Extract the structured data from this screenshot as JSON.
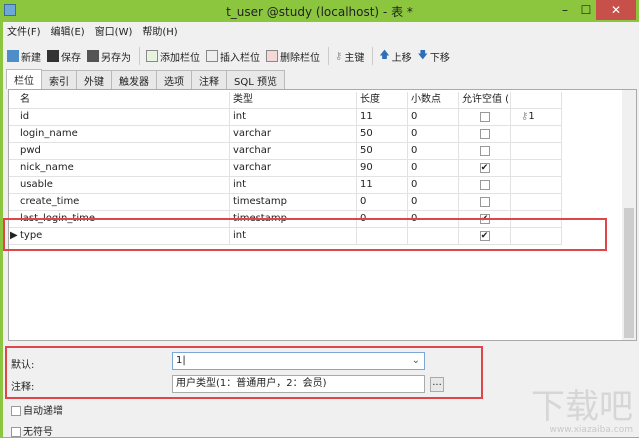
{
  "window": {
    "title": "t_user @study (localhost) - 表 *",
    "minimize": "–",
    "maximize": "☐",
    "close": "✕"
  },
  "menu": [
    "文件(F)",
    "编辑(E)",
    "窗口(W)",
    "帮助(H)"
  ],
  "toolbar": {
    "new": "新建",
    "save": "保存",
    "save_as": "另存为",
    "add_field": "添加栏位",
    "insert_field": "插入栏位",
    "delete_field": "删除栏位",
    "primary_key": "主键",
    "move_up": "上移",
    "move_down": "下移"
  },
  "tabs": [
    "栏位",
    "索引",
    "外键",
    "触发器",
    "选项",
    "注释",
    "SQL 预览"
  ],
  "grid": {
    "headers": [
      "名",
      "类型",
      "长度",
      "小数点",
      "允许空值 ("
    ],
    "rows": [
      {
        "name": "id",
        "type": "int",
        "length": "11",
        "decimal": "0",
        "nullable": false,
        "key": "1"
      },
      {
        "name": "login_name",
        "type": "varchar",
        "length": "50",
        "decimal": "0",
        "nullable": false,
        "key": ""
      },
      {
        "name": "pwd",
        "type": "varchar",
        "length": "50",
        "decimal": "0",
        "nullable": false,
        "key": ""
      },
      {
        "name": "nick_name",
        "type": "varchar",
        "length": "90",
        "decimal": "0",
        "nullable": true,
        "key": ""
      },
      {
        "name": "usable",
        "type": "int",
        "length": "11",
        "decimal": "0",
        "nullable": false,
        "key": ""
      },
      {
        "name": "create_time",
        "type": "timestamp",
        "length": "0",
        "decimal": "0",
        "nullable": false,
        "key": ""
      },
      {
        "name": "last_login_time",
        "type": "timestamp",
        "length": "0",
        "decimal": "0",
        "nullable": true,
        "key": ""
      },
      {
        "name": "type",
        "type": "int",
        "length": "",
        "decimal": "",
        "nullable": true,
        "key": ""
      }
    ]
  },
  "props": {
    "default_label": "默认:",
    "default_value": "1",
    "comment_label": "注释:",
    "comment_value": "用户类型(1：普通用户，2：会员)",
    "browse": "...",
    "auto_increment": "自动递增",
    "unsigned": "无符号"
  },
  "watermark": {
    "logo": "下载吧",
    "url": "www.xiazaiba.com"
  }
}
